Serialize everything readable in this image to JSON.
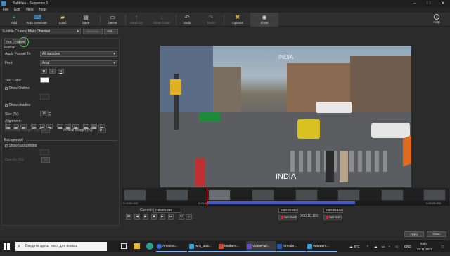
{
  "window": {
    "title": "Subtitles - Sequence 1",
    "min_glyph": "–",
    "max_glyph": "☐",
    "close_glyph": "✕"
  },
  "menu": [
    "File",
    "Edit",
    "View",
    "Help"
  ],
  "toolbar": {
    "items": [
      {
        "label": "Add",
        "icon": "plus-icon",
        "glyph": "+",
        "color": "#35c24a",
        "disabled": false
      },
      {
        "label": "Auto Generate",
        "icon": "auto-generate-icon",
        "glyph": "⌨",
        "color": "#4fb0ff",
        "disabled": false
      },
      {
        "label": "Load",
        "icon": "folder-icon",
        "glyph": "▰",
        "color": "#e8c24a",
        "disabled": false
      },
      {
        "label": "Save",
        "icon": "save-icon",
        "glyph": "▤",
        "color": "#d8d8d8",
        "disabled": false
      },
      {
        "label": "Delete",
        "icon": "delete-icon",
        "glyph": "▭",
        "color": "#d8d8d8",
        "disabled": false
      },
      {
        "label": "Move Up",
        "icon": "move-up-icon",
        "glyph": "↑",
        "color": "#777",
        "disabled": true
      },
      {
        "label": "Move Down",
        "icon": "move-down-icon",
        "glyph": "↓",
        "color": "#777",
        "disabled": true
      },
      {
        "label": "Undo",
        "icon": "undo-icon",
        "glyph": "↶",
        "color": "#d8d8d8",
        "disabled": false
      },
      {
        "label": "Redo",
        "icon": "redo-icon",
        "glyph": "↷",
        "color": "#777",
        "disabled": true
      },
      {
        "label": "Options",
        "icon": "options-icon",
        "glyph": "✖",
        "color": "#e0b040",
        "disabled": false
      },
      {
        "label": "Show",
        "icon": "eye-icon",
        "glyph": "◉",
        "color": "#d8d8d8",
        "disabled": false
      }
    ],
    "help": {
      "label": "Help",
      "icon": "help-icon",
      "glyph": "?"
    }
  },
  "channel": {
    "label": "Subtitle Channel:",
    "value": "Main Channel",
    "remove_label": "Remove",
    "add_label": "Add..."
  },
  "tabs": [
    "Text",
    "Format"
  ],
  "format": {
    "section": "Format",
    "apply_to_label": "Apply Format To:",
    "apply_to_value": "All subtitles",
    "font_label": "Font:",
    "font_value": "Arial",
    "bold": "B",
    "italic": "I",
    "underline": "U",
    "text_color_label": "Text Color:",
    "text_color": "#ffffff",
    "show_outline": "Show Outline",
    "show_shadow": "Show shadow",
    "size_label": "Size (%):",
    "size_value": "10",
    "alignment_label": "Alignment:",
    "horizontal_margin_label": "Horizontal Margin (%):",
    "horizontal_margin_value": "0",
    "vertical_margin_label": "Vertical Margin (%):",
    "vertical_margin_value": "0"
  },
  "background": {
    "section": "Background",
    "show_background": "Show background",
    "opacity_label": "Opacity (%):",
    "opacity_value": "50"
  },
  "video": {
    "caption": "INDIA",
    "sign": "INDIA"
  },
  "timeline": {
    "start_time": "0:00:00.000",
    "mark_time": "0:00:10.000",
    "end_time": "0:00:25.000"
  },
  "transport": {
    "current_label": "Current:",
    "current_value": "0:00:09.983",
    "start_value": "0:00:09.983",
    "duration_value": "0:00:10.151",
    "end_value": "0:00:20.133",
    "set_start": "Set Start",
    "set_end": "Set End"
  },
  "dialog": {
    "apply": "Apply",
    "close": "Close"
  },
  "taskbar": {
    "search_placeholder": "Введите здесь текст для поиска",
    "apps": [
      {
        "label": "Amazon...",
        "color": "#2f6ee0"
      },
      {
        "label": "IMG_344...",
        "color": "#2fa3e6"
      },
      {
        "label": "Mathem...",
        "color": "#d24b2b"
      },
      {
        "label": "VideoPad...",
        "color": "#6b4fc2"
      },
      {
        "label": "formula ...",
        "color": "#2b5aa8"
      },
      {
        "label": "Wonders...",
        "color": "#3aa0d8"
      }
    ],
    "weather": "5°C",
    "language": "ENG",
    "time": "0:00",
    "date": "23.11.2021"
  }
}
